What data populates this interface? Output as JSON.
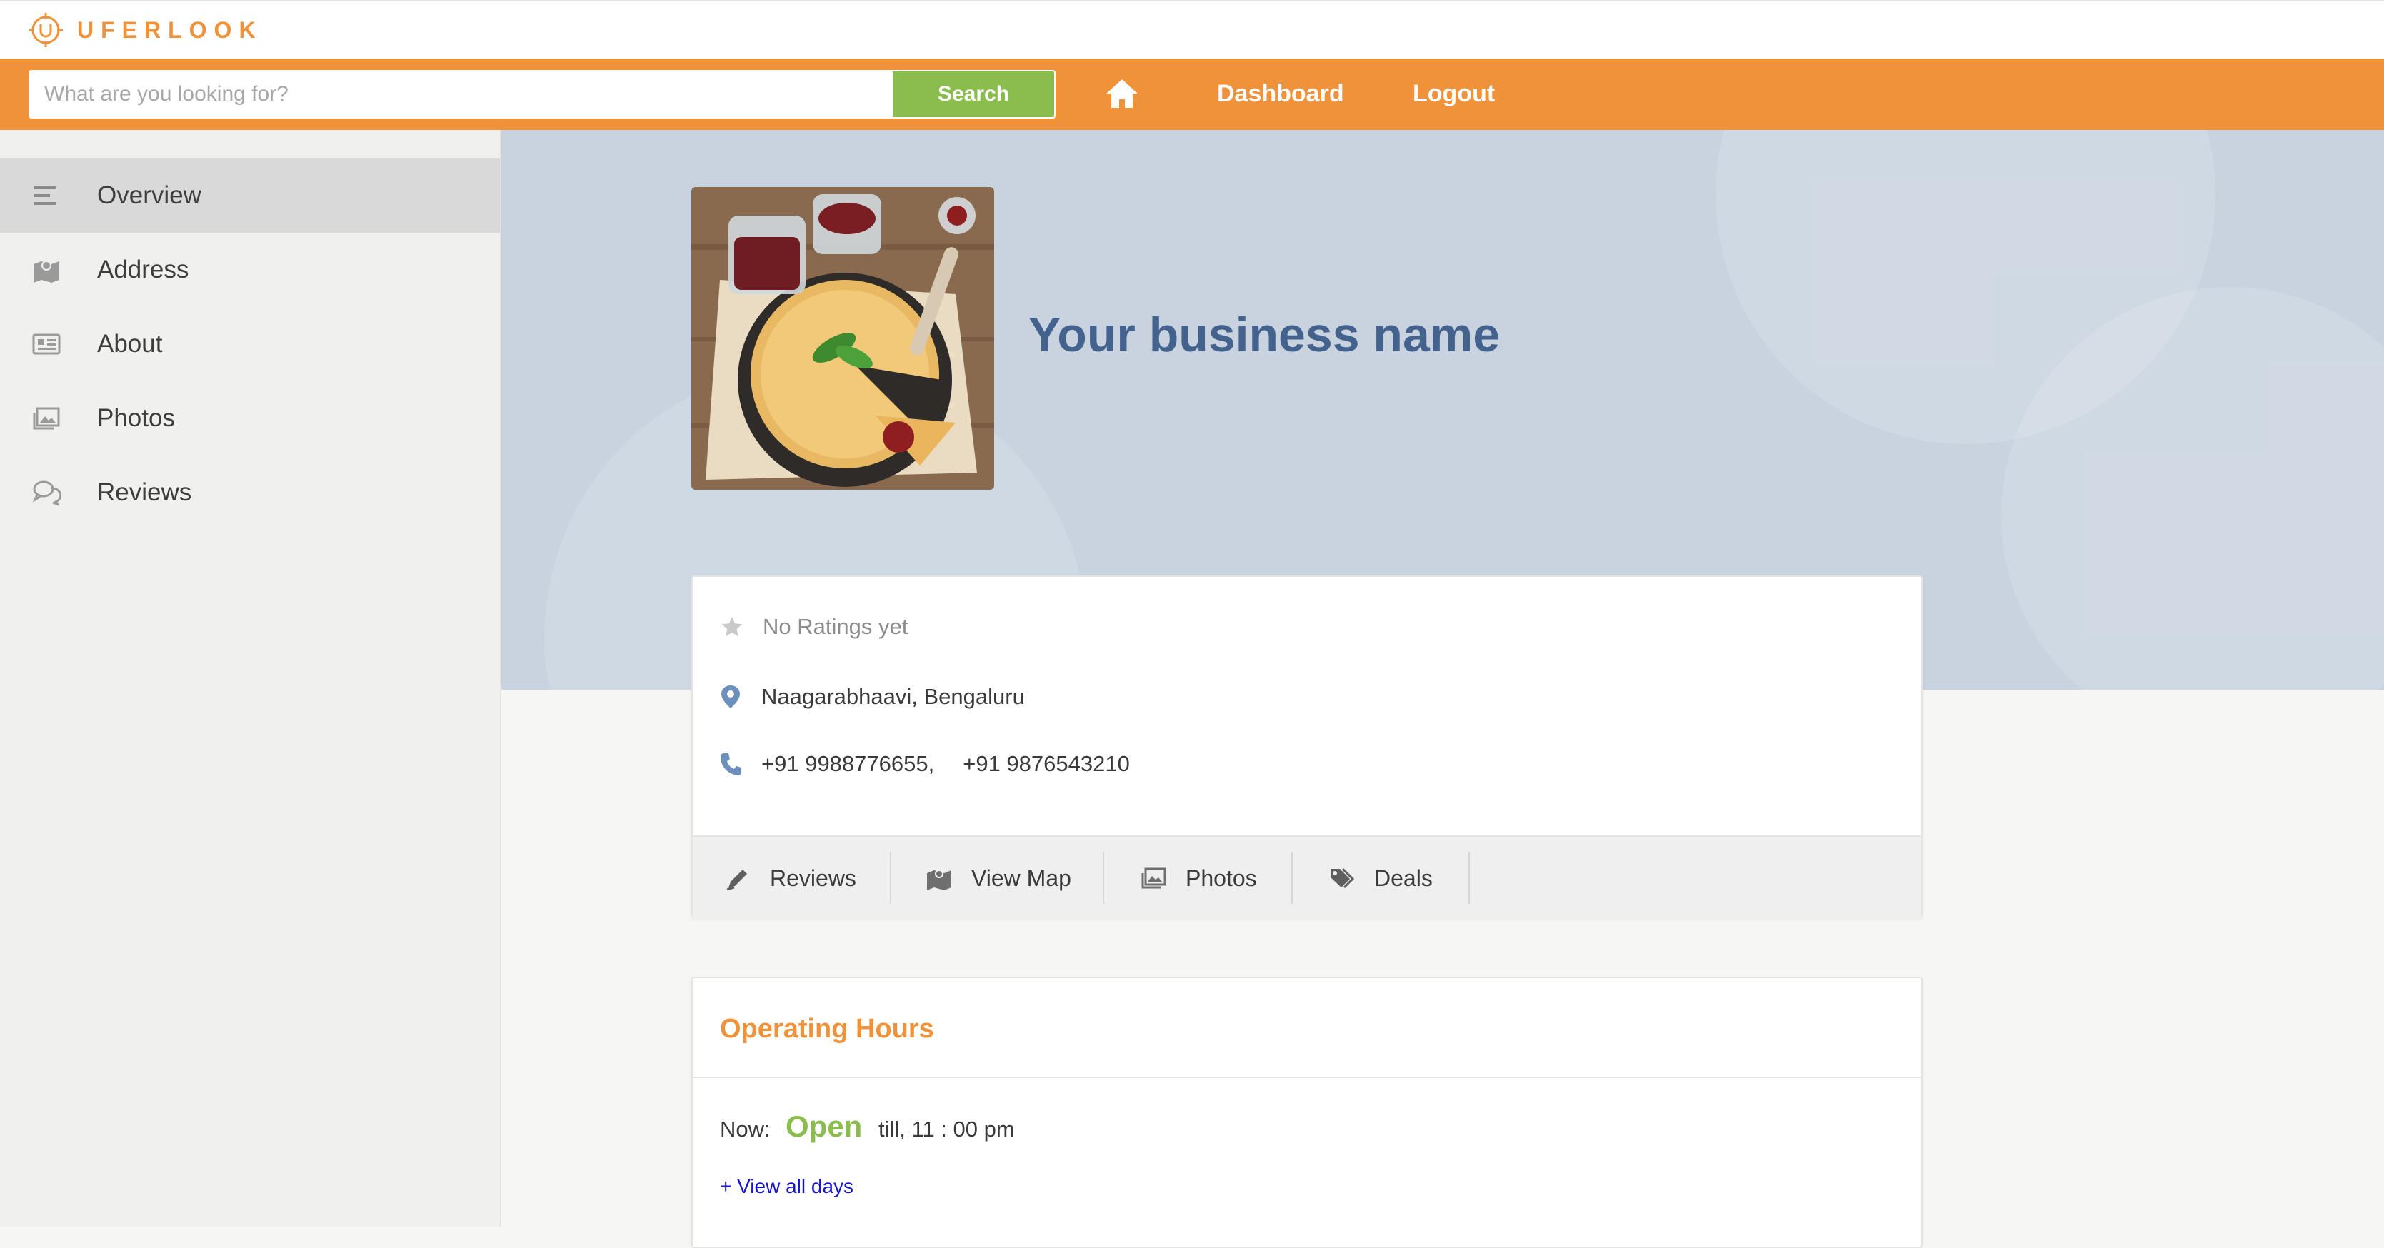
{
  "brand": {
    "name": "UFERLOOK",
    "color": "#f0923a"
  },
  "search": {
    "placeholder": "What are you looking for?",
    "value": "",
    "button_label": "Search"
  },
  "nav": {
    "dashboard_label": "Dashboard",
    "logout_label": "Logout",
    "home_icon": "home-icon"
  },
  "sidebar": {
    "items": [
      {
        "label": "Overview",
        "icon": "list-icon",
        "active": true
      },
      {
        "label": "Address",
        "icon": "map-icon",
        "active": false
      },
      {
        "label": "About",
        "icon": "id-card-icon",
        "active": false
      },
      {
        "label": "Photos",
        "icon": "photo-icon",
        "active": false
      },
      {
        "label": "Reviews",
        "icon": "chat-icon",
        "active": false
      }
    ]
  },
  "business": {
    "name": "Your business name",
    "rating_text": "No Ratings yet",
    "address": "Naagarabhaavi, Bengaluru",
    "phone_1": "+91 9988776655,",
    "phone_2": "+91 9876543210"
  },
  "actions": [
    {
      "label": "Reviews",
      "icon": "pen-icon"
    },
    {
      "label": "View Map",
      "icon": "map-icon"
    },
    {
      "label": "Photos",
      "icon": "photo-icon"
    },
    {
      "label": "Deals",
      "icon": "tag-icon"
    }
  ],
  "hours": {
    "title": "Operating Hours",
    "now_label": "Now:",
    "status": "Open",
    "till_text": "till, 11 : 00 pm",
    "view_all_label": "+ View all days"
  },
  "colors": {
    "nav_orange": "#f0923a",
    "accent_green": "#8bbd4e",
    "title_blue": "#44628e",
    "link_blue": "#1515cc"
  }
}
